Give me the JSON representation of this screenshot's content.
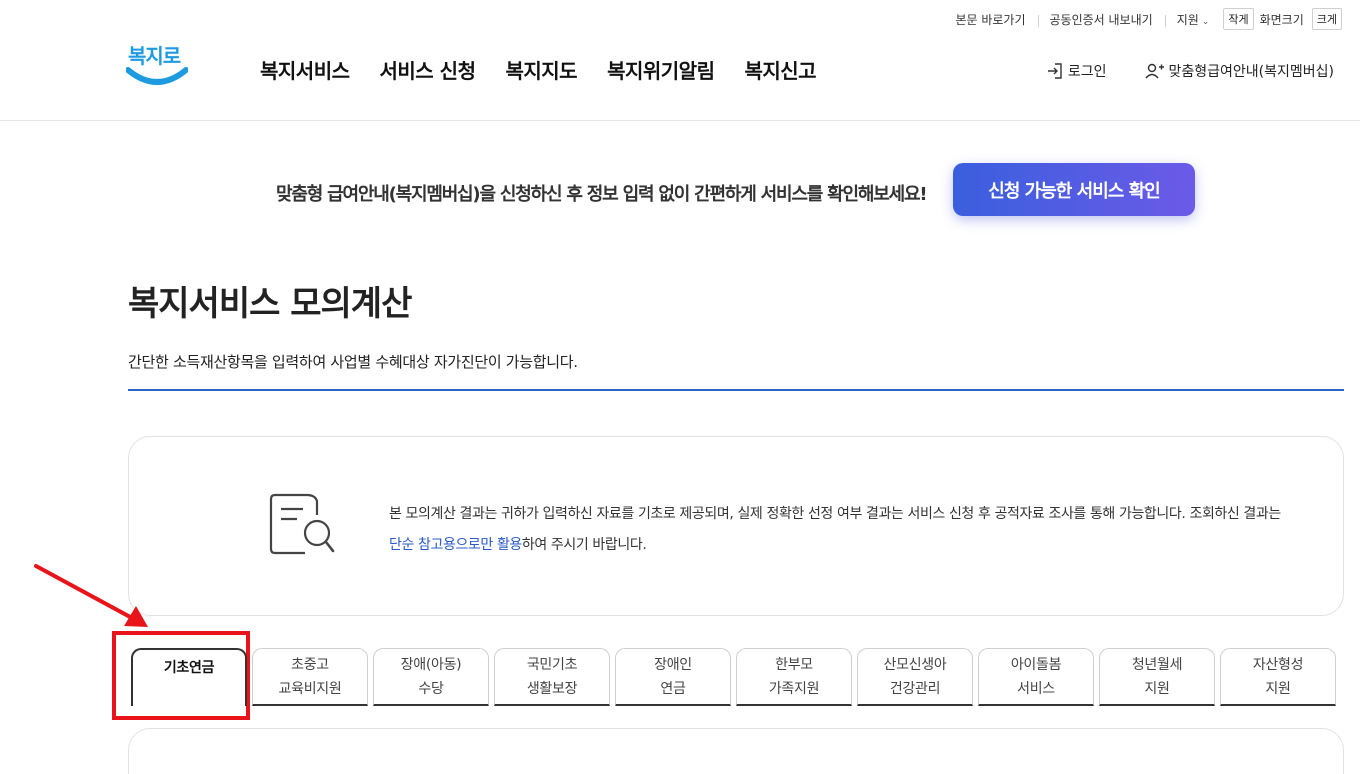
{
  "utility": {
    "skip": "본문 바로가기",
    "cert": "공동인증서 내보내기",
    "support": "지원",
    "font_small": "작게",
    "font_label": "화면크기",
    "font_large": "크게"
  },
  "logo": {
    "text": "복지로"
  },
  "nav": {
    "items": [
      "복지서비스",
      "서비스 신청",
      "복지지도",
      "복지위기알림",
      "복지신고"
    ]
  },
  "header_right": {
    "login": "로그인",
    "membership": "맞춤형급여안내(복지멤버십)"
  },
  "banner": {
    "text": "맞춤형 급여안내(복지멤버십)을 신청하신 후 정보 입력 없이 간편하게 서비스를 확인해보세요!",
    "button": "신청 가능한 서비스 확인"
  },
  "page": {
    "title": "복지서비스 모의계산",
    "description": "간단한 소득재산항목을 입력하여 사업별 수혜대상 자가진단이 가능합니다."
  },
  "notice": {
    "text_before": "본 모의계산 결과는 귀하가 입력하신 자료를 기초로 제공되며, 실제 정확한 선정 여부 결과는 서비스 신청 후 공적자료 조사를 통해 가능합니다. 조회하신 결과는 ",
    "highlight": "단순 참고용으로만 활용",
    "text_after": "하여 주시기 바랍니다."
  },
  "tabs": [
    {
      "line1": "기초연금",
      "line2": ""
    },
    {
      "line1": "초중고",
      "line2": "교육비지원"
    },
    {
      "line1": "장애(아동)",
      "line2": "수당"
    },
    {
      "line1": "국민기초",
      "line2": "생활보장"
    },
    {
      "line1": "장애인",
      "line2": "연금"
    },
    {
      "line1": "한부모",
      "line2": "가족지원"
    },
    {
      "line1": "산모신생아",
      "line2": "건강관리"
    },
    {
      "line1": "아이돌봄",
      "line2": "서비스"
    },
    {
      "line1": "청년월세",
      "line2": "지원"
    },
    {
      "line1": "자산형성",
      "line2": "지원"
    }
  ],
  "colors": {
    "accent_blue": "#2a66c6",
    "button_gradient_start": "#3a5fde",
    "button_gradient_end": "#6b5ae8",
    "annotation_red": "#e8141a",
    "logo_blue": "#1e9be0"
  }
}
